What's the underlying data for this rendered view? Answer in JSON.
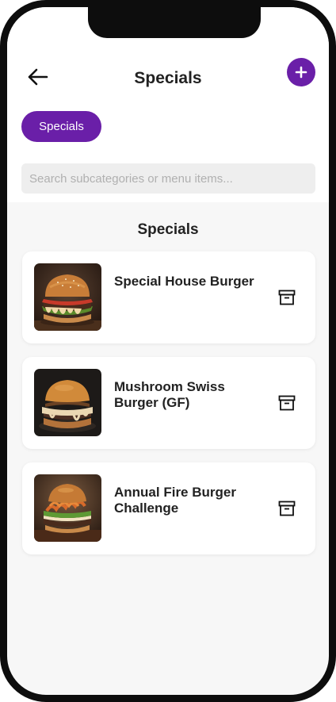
{
  "header": {
    "title": "Specials",
    "back_icon": "arrow-left-icon",
    "add_icon": "plus-icon"
  },
  "filter_chip": {
    "label": "Specials"
  },
  "search": {
    "placeholder": "Search subcategories or menu items...",
    "value": ""
  },
  "section": {
    "title": "Specials"
  },
  "items": [
    {
      "name": "Special House Burger",
      "image": "burger-photo",
      "action_icon": "archive-icon"
    },
    {
      "name": "Mushroom Swiss Burger (GF)",
      "image": "burger-photo",
      "action_icon": "archive-icon"
    },
    {
      "name": "Annual Fire Burger Challenge",
      "image": "burger-photo",
      "action_icon": "archive-icon"
    }
  ],
  "colors": {
    "accent": "#6a1fa8",
    "background": "#f7f7f7",
    "card": "#ffffff",
    "text": "#222222"
  }
}
